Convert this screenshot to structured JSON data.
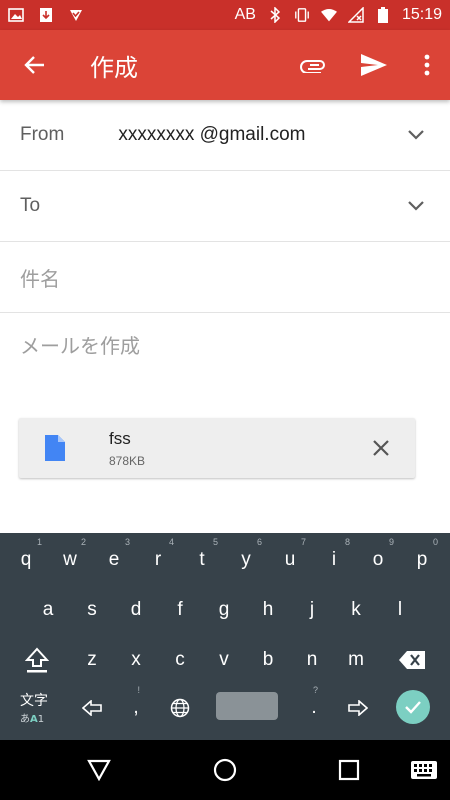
{
  "status_bar": {
    "left_icons": [
      "image-icon",
      "download-icon",
      "check-icon"
    ],
    "indicator": "AB",
    "right_icons": [
      "bluetooth-icon",
      "vibrate-icon",
      "wifi-icon",
      "no-signal-icon",
      "battery-icon"
    ],
    "time": "15:19"
  },
  "app_bar": {
    "title": "作成",
    "back_icon": "arrow-left-icon",
    "actions": [
      "paperclip-icon",
      "send-icon",
      "more-vert-icon"
    ],
    "color": "#db4437"
  },
  "form": {
    "from_label": "From",
    "from_value": "xxxxxxxx @gmail.com",
    "to_label": "To",
    "subject_placeholder": "件名",
    "body_placeholder": "メールを作成"
  },
  "attachment": {
    "name": "fss",
    "size": "878KB"
  },
  "keyboard": {
    "row1": [
      "q",
      "w",
      "e",
      "r",
      "t",
      "y",
      "u",
      "i",
      "o",
      "p"
    ],
    "row1_hints": [
      "1",
      "2",
      "3",
      "4",
      "5",
      "6",
      "7",
      "8",
      "9",
      "0"
    ],
    "row2": [
      "a",
      "s",
      "d",
      "f",
      "g",
      "h",
      "j",
      "k",
      "l"
    ],
    "row3": [
      "z",
      "x",
      "c",
      "v",
      "b",
      "n",
      "m"
    ],
    "comma": ",",
    "comma_hint": "!",
    "period": ".",
    "period_hint": "?",
    "mode_label": "文字",
    "mode_sub_a": "あ",
    "mode_sub_b": "A",
    "mode_sub_c": "1"
  },
  "nav_bar": [
    "back-triangle-icon",
    "home-circle-icon",
    "recents-square-icon",
    "keyboard-icon"
  ]
}
